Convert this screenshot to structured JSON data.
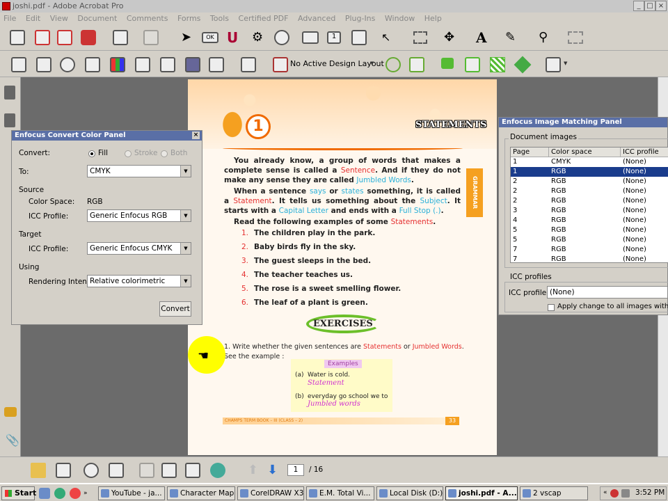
{
  "window": {
    "title": "joshi.pdf - Adobe Acrobat Pro"
  },
  "menu": [
    "File",
    "Edit",
    "View",
    "Document",
    "Comments",
    "Forms",
    "Tools",
    "Certified PDF",
    "Advanced",
    "Plug-Ins",
    "Window",
    "Help"
  ],
  "toolbar2": {
    "design_layout": "No Active Design Layout"
  },
  "page": {
    "chapter_number": "1",
    "title": "STATEMENTS",
    "side_tab": "GRAMMAR",
    "p1_a": "You already know, a group of words that makes a complete sense is called a ",
    "p1_sentence": "Sentence",
    "p1_b": ". And if they do not make any sense they are called ",
    "p1_jumbled": "Jumbled Words",
    "p1_c": ".",
    "p2_a": "When a sentence ",
    "p2_says": "says",
    "p2_b": " or ",
    "p2_states": "states",
    "p2_c": " something, it is called a ",
    "p2_statement": "Statement",
    "p2_d": ". It tells us something about the ",
    "p2_subject": "Subject",
    "p2_e": ". It starts with a ",
    "p2_capital": "Capital Letter",
    "p2_f": " and ends with a ",
    "p2_fullstop": "Full Stop (.)",
    "p2_g": ".",
    "p3_a": "Read the following examples of some ",
    "p3_statements": "Statements",
    "p3_b": ".",
    "examples": [
      {
        "num": "1.",
        "text": "The children play in the park."
      },
      {
        "num": "2.",
        "text": "Baby birds fly in the sky."
      },
      {
        "num": "3.",
        "text": "The guest sleeps in the bed."
      },
      {
        "num": "4.",
        "text": "The teacher teaches us."
      },
      {
        "num": "5.",
        "text": "The rose is a sweet smelling flower."
      },
      {
        "num": "6.",
        "text": "The leaf of a plant is green."
      }
    ],
    "exercises": "EXERCISES",
    "q1_num": "1.",
    "q1_a": "Write whether the given sentences are ",
    "q1_statements": "Statements",
    "q1_b": " or ",
    "q1_jumbled": "Jumbled Words",
    "q1_c": ". See the example :",
    "ex_label": "Examples",
    "ex_a_label": "(a)",
    "ex_a_text": "Water is cold.",
    "ex_a_answer": "Statement",
    "ex_b_label": "(b)",
    "ex_b_text": "everyday go school we to",
    "ex_b_answer": "Jumbled words",
    "footer": "CHAMPS TERM BOOK – III (CLASS – 2)",
    "page_number": "33"
  },
  "convert_panel": {
    "title": "Enfocus Convert Color Panel",
    "convert_label": "Convert:",
    "fill": "Fill",
    "stroke": "Stroke",
    "both": "Both",
    "to_label": "To:",
    "to_value": "CMYK",
    "source": "Source",
    "color_space_label": "Color Space:",
    "color_space_value": "RGB",
    "icc_profile_label": "ICC Profile:",
    "source_icc": "Generic Enfocus RGB",
    "target": "Target",
    "target_icc": "Generic Enfocus CMYK",
    "using": "Using",
    "rendering_intent_label": "Rendering Intent:",
    "rendering_intent": "Relative colorimetric",
    "convert_button": "Convert"
  },
  "matching_panel": {
    "title": "Enfocus Image Matching Panel",
    "doc_images": "Document images",
    "columns": [
      "Page",
      "Color space",
      "ICC profile"
    ],
    "rows": [
      [
        "1",
        "CMYK",
        "(None)"
      ],
      [
        "1",
        "RGB",
        "(None)"
      ],
      [
        "2",
        "RGB",
        "(None)"
      ],
      [
        "2",
        "RGB",
        "(None)"
      ],
      [
        "2",
        "RGB",
        "(None)"
      ],
      [
        "3",
        "RGB",
        "(None)"
      ],
      [
        "4",
        "RGB",
        "(None)"
      ],
      [
        "5",
        "RGB",
        "(None)"
      ],
      [
        "5",
        "RGB",
        "(None)"
      ],
      [
        "7",
        "RGB",
        "(None)"
      ],
      [
        "7",
        "RGB",
        "(None)"
      ]
    ],
    "icc_profiles": "ICC profiles",
    "icc_profile_label": "ICC profile:",
    "icc_profile_value": "(None)",
    "apply_change": "Apply change to all images with the s"
  },
  "nav": {
    "page_input": "1",
    "page_total": "/ 16"
  },
  "taskbar": {
    "start": "Start",
    "tasks": [
      "YouTube - ja...",
      "Character Map",
      "CorelDRAW X3",
      "E.M. Total Vi...",
      "Local Disk (D:)",
      "joshi.pdf - A...",
      "2 vscap"
    ],
    "clock": "3:52 PM"
  }
}
